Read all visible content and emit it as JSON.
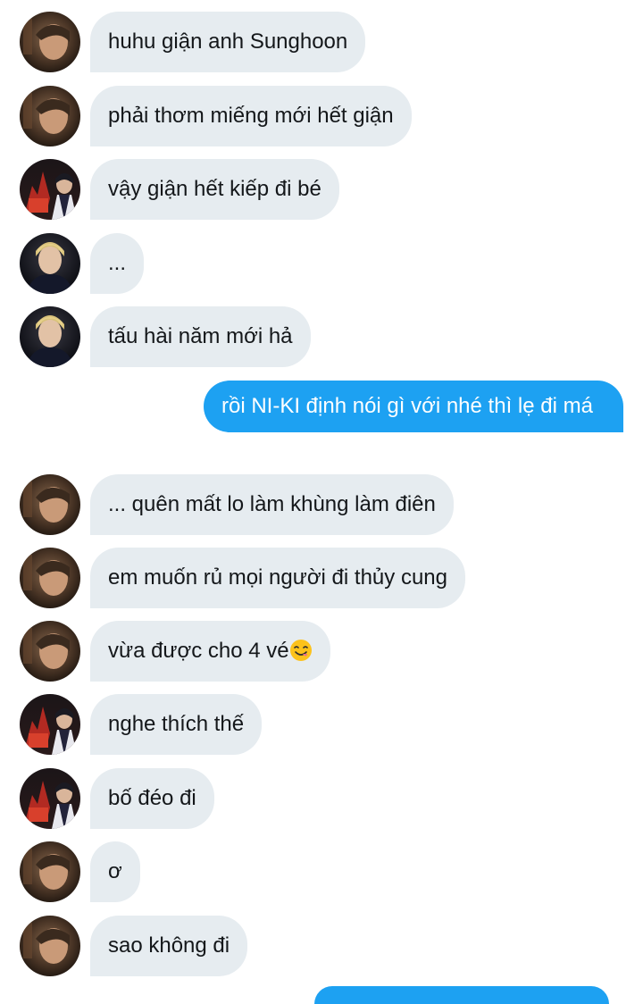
{
  "conversation": {
    "messages": [
      {
        "sender": "sunghoon",
        "text": "huhu giận anh Sunghoon"
      },
      {
        "sender": "sunghoon",
        "text": "phải thơm miếng mới hết giận"
      },
      {
        "sender": "couple",
        "text": "vậy giận hết kiếp đi bé"
      },
      {
        "sender": "blond",
        "text": "..."
      },
      {
        "sender": "blond",
        "text": "tấu hài năm mới hả"
      },
      {
        "sender": "me",
        "text": "rồi NI-KI định nói gì với nhé thì lẹ đi má"
      },
      {
        "sender": "sunghoon",
        "text": "... quên mất lo làm khùng làm điên"
      },
      {
        "sender": "sunghoon",
        "text": "em muốn rủ mọi người đi thủy cung"
      },
      {
        "sender": "sunghoon",
        "text": "vừa được cho 4 vé",
        "emoji": "face-savoring-food-icon"
      },
      {
        "sender": "couple",
        "text": "nghe thích thế"
      },
      {
        "sender": "couple",
        "text": "bố đéo đi"
      },
      {
        "sender": "sunghoon",
        "text": "ơ"
      },
      {
        "sender": "sunghoon",
        "text": "sao không đi"
      }
    ]
  },
  "colors": {
    "incoming_bubble": "#e6ecf0",
    "outgoing_bubble": "#1da1f2",
    "incoming_text": "#14171a",
    "outgoing_text": "#ffffff"
  }
}
